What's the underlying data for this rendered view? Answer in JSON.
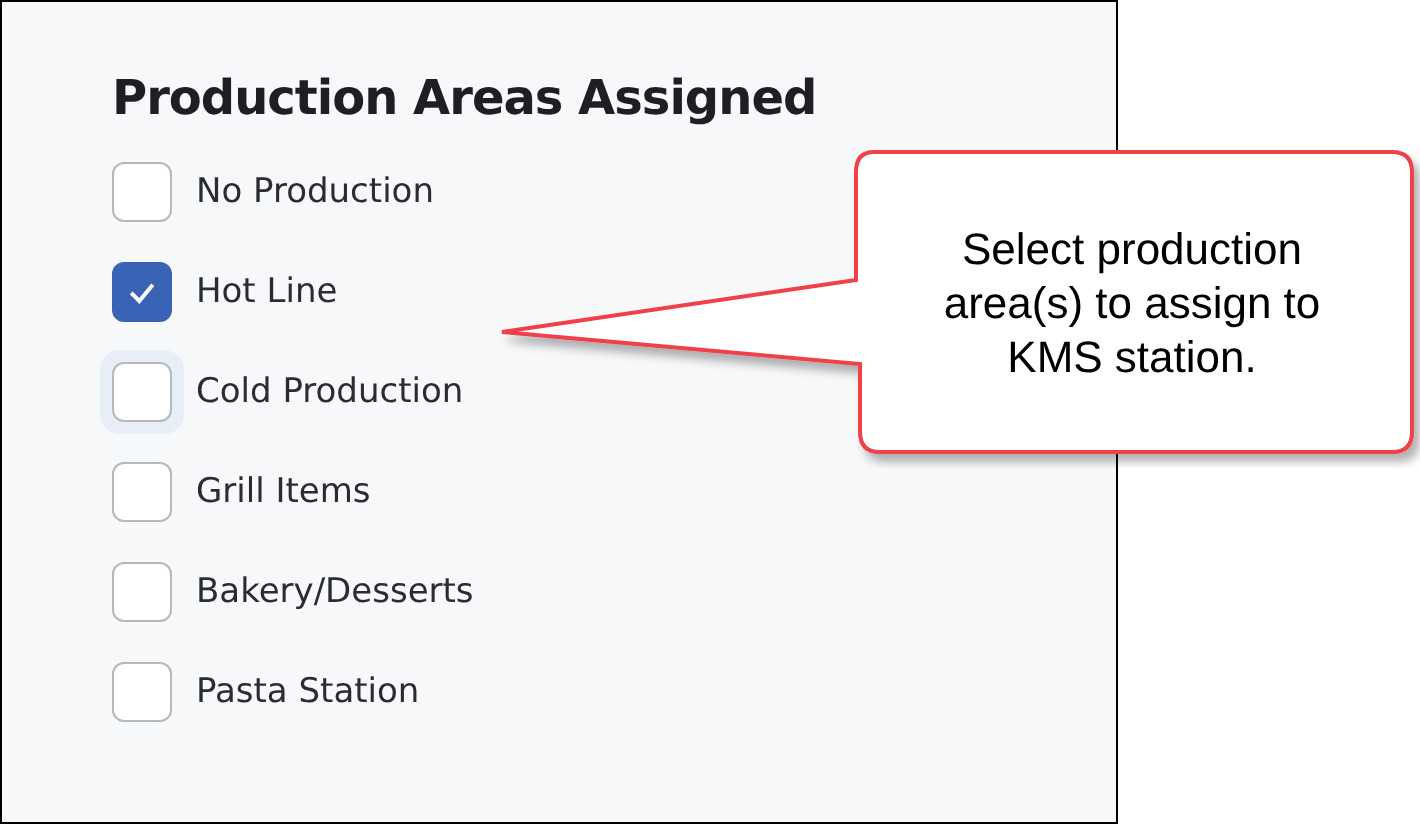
{
  "panel": {
    "title": "Production Areas Assigned",
    "options": [
      {
        "label": "No Production",
        "checked": false,
        "focused": false
      },
      {
        "label": "Hot Line",
        "checked": true,
        "focused": false
      },
      {
        "label": "Cold Production",
        "checked": false,
        "focused": true
      },
      {
        "label": "Grill Items",
        "checked": false,
        "focused": false
      },
      {
        "label": "Bakery/Desserts",
        "checked": false,
        "focused": false
      },
      {
        "label": "Pasta Station",
        "checked": false,
        "focused": false
      }
    ]
  },
  "callout": {
    "text": "Select production area(s) to assign to KMS station."
  }
}
